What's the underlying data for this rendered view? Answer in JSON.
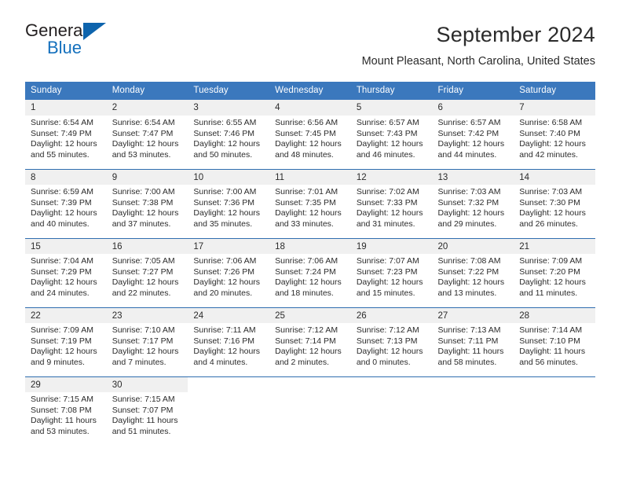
{
  "brand": {
    "name_top": "General",
    "name_bottom": "Blue",
    "accent_color": "#1470bd",
    "triangle_color": "#0e64ad"
  },
  "header": {
    "month_title": "September 2024",
    "location": "Mount Pleasant, North Carolina, United States"
  },
  "calendar": {
    "header_bg": "#3b78bd",
    "daynum_bg": "#f0f0f0",
    "row_border": "#2f6daf",
    "weekdays": [
      "Sunday",
      "Monday",
      "Tuesday",
      "Wednesday",
      "Thursday",
      "Friday",
      "Saturday"
    ],
    "weeks": [
      [
        {
          "day": "1",
          "sunrise": "Sunrise: 6:54 AM",
          "sunset": "Sunset: 7:49 PM",
          "daylight1": "Daylight: 12 hours",
          "daylight2": "and 55 minutes."
        },
        {
          "day": "2",
          "sunrise": "Sunrise: 6:54 AM",
          "sunset": "Sunset: 7:47 PM",
          "daylight1": "Daylight: 12 hours",
          "daylight2": "and 53 minutes."
        },
        {
          "day": "3",
          "sunrise": "Sunrise: 6:55 AM",
          "sunset": "Sunset: 7:46 PM",
          "daylight1": "Daylight: 12 hours",
          "daylight2": "and 50 minutes."
        },
        {
          "day": "4",
          "sunrise": "Sunrise: 6:56 AM",
          "sunset": "Sunset: 7:45 PM",
          "daylight1": "Daylight: 12 hours",
          "daylight2": "and 48 minutes."
        },
        {
          "day": "5",
          "sunrise": "Sunrise: 6:57 AM",
          "sunset": "Sunset: 7:43 PM",
          "daylight1": "Daylight: 12 hours",
          "daylight2": "and 46 minutes."
        },
        {
          "day": "6",
          "sunrise": "Sunrise: 6:57 AM",
          "sunset": "Sunset: 7:42 PM",
          "daylight1": "Daylight: 12 hours",
          "daylight2": "and 44 minutes."
        },
        {
          "day": "7",
          "sunrise": "Sunrise: 6:58 AM",
          "sunset": "Sunset: 7:40 PM",
          "daylight1": "Daylight: 12 hours",
          "daylight2": "and 42 minutes."
        }
      ],
      [
        {
          "day": "8",
          "sunrise": "Sunrise: 6:59 AM",
          "sunset": "Sunset: 7:39 PM",
          "daylight1": "Daylight: 12 hours",
          "daylight2": "and 40 minutes."
        },
        {
          "day": "9",
          "sunrise": "Sunrise: 7:00 AM",
          "sunset": "Sunset: 7:38 PM",
          "daylight1": "Daylight: 12 hours",
          "daylight2": "and 37 minutes."
        },
        {
          "day": "10",
          "sunrise": "Sunrise: 7:00 AM",
          "sunset": "Sunset: 7:36 PM",
          "daylight1": "Daylight: 12 hours",
          "daylight2": "and 35 minutes."
        },
        {
          "day": "11",
          "sunrise": "Sunrise: 7:01 AM",
          "sunset": "Sunset: 7:35 PM",
          "daylight1": "Daylight: 12 hours",
          "daylight2": "and 33 minutes."
        },
        {
          "day": "12",
          "sunrise": "Sunrise: 7:02 AM",
          "sunset": "Sunset: 7:33 PM",
          "daylight1": "Daylight: 12 hours",
          "daylight2": "and 31 minutes."
        },
        {
          "day": "13",
          "sunrise": "Sunrise: 7:03 AM",
          "sunset": "Sunset: 7:32 PM",
          "daylight1": "Daylight: 12 hours",
          "daylight2": "and 29 minutes."
        },
        {
          "day": "14",
          "sunrise": "Sunrise: 7:03 AM",
          "sunset": "Sunset: 7:30 PM",
          "daylight1": "Daylight: 12 hours",
          "daylight2": "and 26 minutes."
        }
      ],
      [
        {
          "day": "15",
          "sunrise": "Sunrise: 7:04 AM",
          "sunset": "Sunset: 7:29 PM",
          "daylight1": "Daylight: 12 hours",
          "daylight2": "and 24 minutes."
        },
        {
          "day": "16",
          "sunrise": "Sunrise: 7:05 AM",
          "sunset": "Sunset: 7:27 PM",
          "daylight1": "Daylight: 12 hours",
          "daylight2": "and 22 minutes."
        },
        {
          "day": "17",
          "sunrise": "Sunrise: 7:06 AM",
          "sunset": "Sunset: 7:26 PM",
          "daylight1": "Daylight: 12 hours",
          "daylight2": "and 20 minutes."
        },
        {
          "day": "18",
          "sunrise": "Sunrise: 7:06 AM",
          "sunset": "Sunset: 7:24 PM",
          "daylight1": "Daylight: 12 hours",
          "daylight2": "and 18 minutes."
        },
        {
          "day": "19",
          "sunrise": "Sunrise: 7:07 AM",
          "sunset": "Sunset: 7:23 PM",
          "daylight1": "Daylight: 12 hours",
          "daylight2": "and 15 minutes."
        },
        {
          "day": "20",
          "sunrise": "Sunrise: 7:08 AM",
          "sunset": "Sunset: 7:22 PM",
          "daylight1": "Daylight: 12 hours",
          "daylight2": "and 13 minutes."
        },
        {
          "day": "21",
          "sunrise": "Sunrise: 7:09 AM",
          "sunset": "Sunset: 7:20 PM",
          "daylight1": "Daylight: 12 hours",
          "daylight2": "and 11 minutes."
        }
      ],
      [
        {
          "day": "22",
          "sunrise": "Sunrise: 7:09 AM",
          "sunset": "Sunset: 7:19 PM",
          "daylight1": "Daylight: 12 hours",
          "daylight2": "and 9 minutes."
        },
        {
          "day": "23",
          "sunrise": "Sunrise: 7:10 AM",
          "sunset": "Sunset: 7:17 PM",
          "daylight1": "Daylight: 12 hours",
          "daylight2": "and 7 minutes."
        },
        {
          "day": "24",
          "sunrise": "Sunrise: 7:11 AM",
          "sunset": "Sunset: 7:16 PM",
          "daylight1": "Daylight: 12 hours",
          "daylight2": "and 4 minutes."
        },
        {
          "day": "25",
          "sunrise": "Sunrise: 7:12 AM",
          "sunset": "Sunset: 7:14 PM",
          "daylight1": "Daylight: 12 hours",
          "daylight2": "and 2 minutes."
        },
        {
          "day": "26",
          "sunrise": "Sunrise: 7:12 AM",
          "sunset": "Sunset: 7:13 PM",
          "daylight1": "Daylight: 12 hours",
          "daylight2": "and 0 minutes."
        },
        {
          "day": "27",
          "sunrise": "Sunrise: 7:13 AM",
          "sunset": "Sunset: 7:11 PM",
          "daylight1": "Daylight: 11 hours",
          "daylight2": "and 58 minutes."
        },
        {
          "day": "28",
          "sunrise": "Sunrise: 7:14 AM",
          "sunset": "Sunset: 7:10 PM",
          "daylight1": "Daylight: 11 hours",
          "daylight2": "and 56 minutes."
        }
      ],
      [
        {
          "day": "29",
          "sunrise": "Sunrise: 7:15 AM",
          "sunset": "Sunset: 7:08 PM",
          "daylight1": "Daylight: 11 hours",
          "daylight2": "and 53 minutes."
        },
        {
          "day": "30",
          "sunrise": "Sunrise: 7:15 AM",
          "sunset": "Sunset: 7:07 PM",
          "daylight1": "Daylight: 11 hours",
          "daylight2": "and 51 minutes."
        },
        {
          "day": "",
          "sunrise": "",
          "sunset": "",
          "daylight1": "",
          "daylight2": ""
        },
        {
          "day": "",
          "sunrise": "",
          "sunset": "",
          "daylight1": "",
          "daylight2": ""
        },
        {
          "day": "",
          "sunrise": "",
          "sunset": "",
          "daylight1": "",
          "daylight2": ""
        },
        {
          "day": "",
          "sunrise": "",
          "sunset": "",
          "daylight1": "",
          "daylight2": ""
        },
        {
          "day": "",
          "sunrise": "",
          "sunset": "",
          "daylight1": "",
          "daylight2": ""
        }
      ]
    ]
  }
}
